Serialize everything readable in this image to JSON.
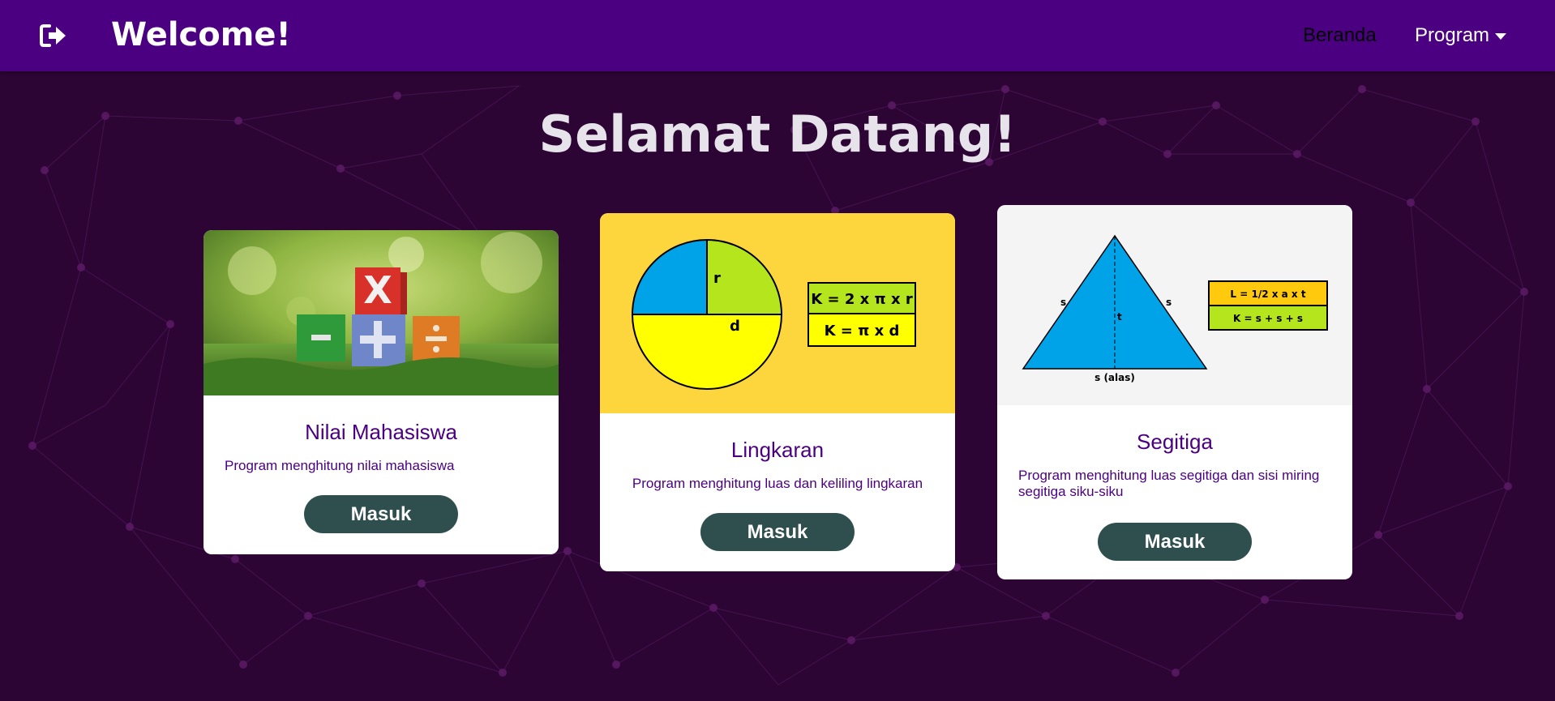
{
  "navbar": {
    "brand": "Welcome!",
    "icon": "logout-icon",
    "links": {
      "home": "Beranda",
      "program": "Program"
    }
  },
  "page": {
    "title": "Selamat Datang!"
  },
  "cards": [
    {
      "title": "Nilai Mahasiswa",
      "description": "Program menghitung nilai mahasiswa",
      "button": "Masuk",
      "image": {
        "block_symbols": [
          "X",
          "−",
          "+",
          "÷"
        ]
      }
    },
    {
      "title": "Lingkaran",
      "description": "Program menghitung luas dan keliling lingkaran",
      "button": "Masuk",
      "image": {
        "labels": [
          "r",
          "d"
        ],
        "formulas": [
          "K = 2 x π x r",
          "K = π x d"
        ]
      }
    },
    {
      "title": "Segitiga",
      "description": "Program menghitung luas segitiga dan sisi miring segitiga siku-siku",
      "button": "Masuk",
      "image": {
        "labels": [
          "s",
          "s",
          "t",
          "s (alas)"
        ],
        "formulas": [
          "L = 1/2 x a x t",
          "K = s + s + s"
        ]
      }
    }
  ],
  "colors": {
    "navbar": "#4b0082",
    "background": "#2d0535",
    "card_text": "#4b0082",
    "button": "#2f4f4f"
  }
}
